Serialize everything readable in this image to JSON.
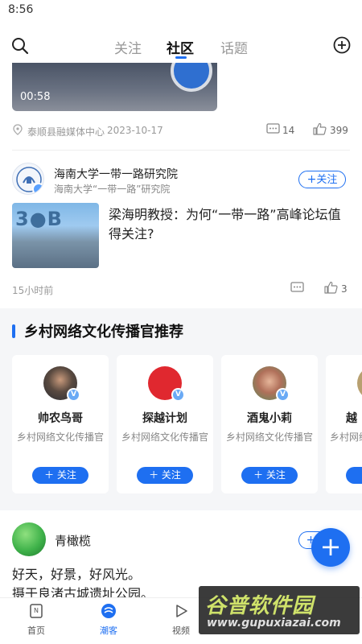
{
  "status_bar": {
    "time": "8:56"
  },
  "top_nav": {
    "tabs": [
      {
        "label": "关注"
      },
      {
        "label": "社区"
      },
      {
        "label": "话题"
      }
    ],
    "active_tab": "社区"
  },
  "post1": {
    "duration": "00:58",
    "source": "泰顺县融媒体中心",
    "date": "2023-10-17",
    "comments": "14",
    "likes": "399"
  },
  "post2": {
    "author": "海南大学一带一路研究院",
    "author_sub": "海南大学“一带一路”研究院",
    "follow_label": "关注",
    "headline": "梁海明教授：为何“一带一路”高峰论坛值得关注?",
    "time": "15小时前",
    "likes": "3"
  },
  "recommend": {
    "title": "乡村网络文化传播官推荐",
    "users": [
      {
        "name": "帅农鸟哥",
        "role": "乡村网络文化传播官",
        "follow": "关注",
        "avatar_color": "#3a3f47"
      },
      {
        "name": "探越计划",
        "role": "乡村网络文化传播官",
        "follow": "关注",
        "avatar_color": "#e0282f"
      },
      {
        "name": "酒鬼小莉",
        "role": "乡村网络文化传播官",
        "follow": "关注",
        "avatar_color": "#c9706a"
      },
      {
        "name": "越",
        "role": "乡村网络",
        "follow": "",
        "avatar_color": "#b8a070"
      }
    ]
  },
  "post3": {
    "author": "青橄榄",
    "text_line1": "好天，好景，好风光。",
    "text_line2": "摄于良渚古城遗址公园。"
  },
  "bottom_tabs": [
    {
      "label": "首页",
      "icon": "home-icon"
    },
    {
      "label": "潮客",
      "icon": "community-icon"
    },
    {
      "label": "视频",
      "icon": "video-icon"
    }
  ],
  "watermark": {
    "main": "谷普软件园",
    "url": "www.gupuxiazai.com"
  },
  "colors": {
    "accent": "#1e6ff1",
    "section_bg": "#f5f6f8"
  }
}
